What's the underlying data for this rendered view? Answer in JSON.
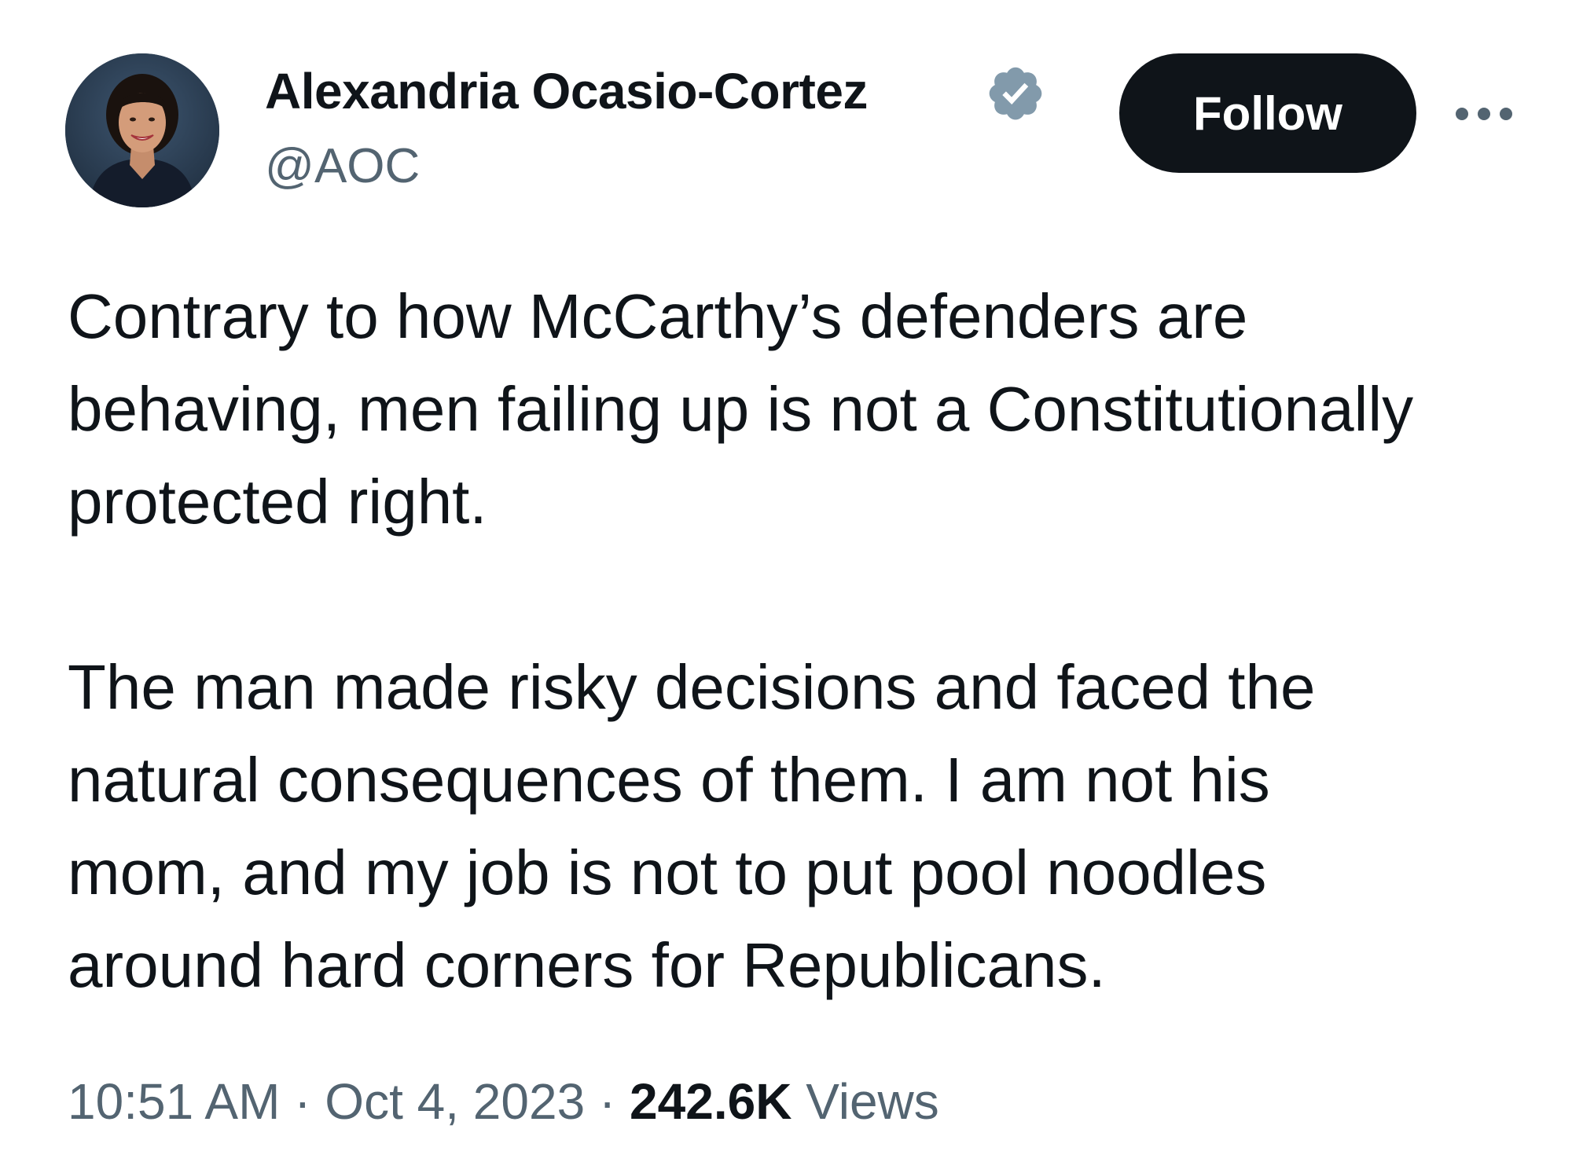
{
  "author": {
    "display_name": "Alexandria Ocasio-Cortez",
    "handle": "@AOC",
    "verified": true,
    "verified_color": "#829aab"
  },
  "actions": {
    "follow_label": "Follow",
    "more_icon": "more-horizontal-icon"
  },
  "tweet": {
    "paragraph1_lines": [
      "Contrary to how McCarthy’s defenders are",
      "behaving, men failing up is not a Constitutionally",
      "protected right."
    ],
    "paragraph2_lines": [
      "The man made risky decisions and faced the",
      "natural consequences of them. I am not his",
      "mom, and my job is not to put pool noodles",
      "around hard corners for Republicans."
    ]
  },
  "meta": {
    "time": "10:51 AM",
    "separator": "·",
    "date": "Oct 4, 2023",
    "views_count": "242.6K",
    "views_label": "Views"
  },
  "colors": {
    "text": "#0f1419",
    "secondary": "#536471",
    "button_bg": "#0f1419",
    "button_text": "#ffffff"
  }
}
